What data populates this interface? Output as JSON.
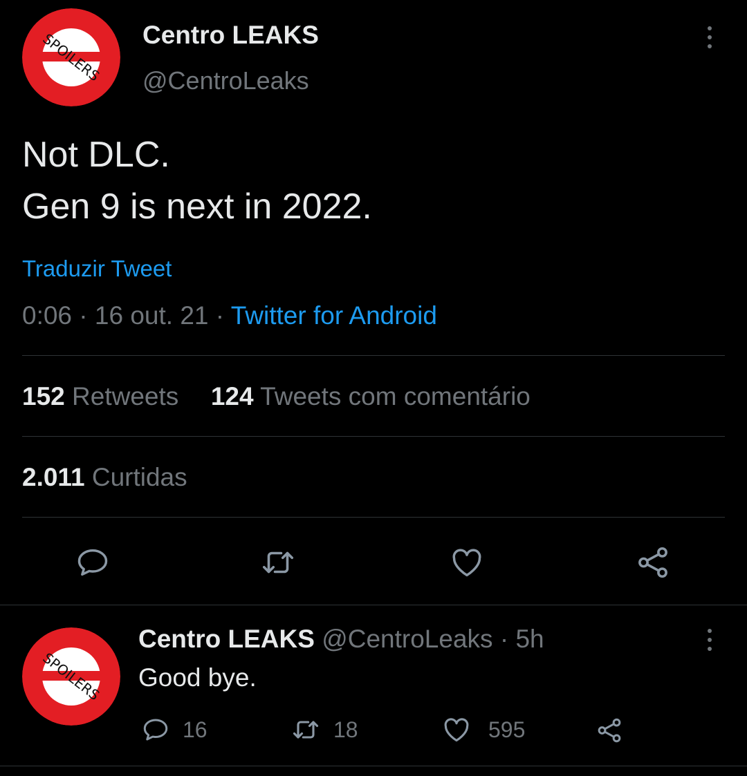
{
  "main_tweet": {
    "author_name": "Centro LEAKS",
    "author_handle": "@CentroLeaks",
    "avatar_text": "SPOILERS",
    "text_line1": "Not DLC.",
    "text_line2": "Gen 9 is next in 2022.",
    "translate_label": "Traduzir Tweet",
    "time": "0:06",
    "separator": "·",
    "date": "16 out. 21",
    "source": "Twitter for Android",
    "retweets_count": "152",
    "retweets_label": "Retweets",
    "quotes_count": "124",
    "quotes_label": "Tweets com comentário",
    "likes_count": "2.011",
    "likes_label": "Curtidas",
    "actions": [
      "reply-icon",
      "retweet-icon",
      "like-icon",
      "share-icon"
    ]
  },
  "reply": {
    "author_name": "Centro LEAKS",
    "author_handle": "@CentroLeaks",
    "separator": "·",
    "age": "5h",
    "avatar_text": "SPOILERS",
    "text": "Good bye.",
    "reply_count": "16",
    "retweet_count": "18",
    "like_count": "595"
  },
  "colors": {
    "background": "#000000",
    "text": "#e7e9ea",
    "muted": "#71767b",
    "link": "#1d9bf0",
    "divider": "#2f3336",
    "avatar_red": "#e31e24"
  }
}
